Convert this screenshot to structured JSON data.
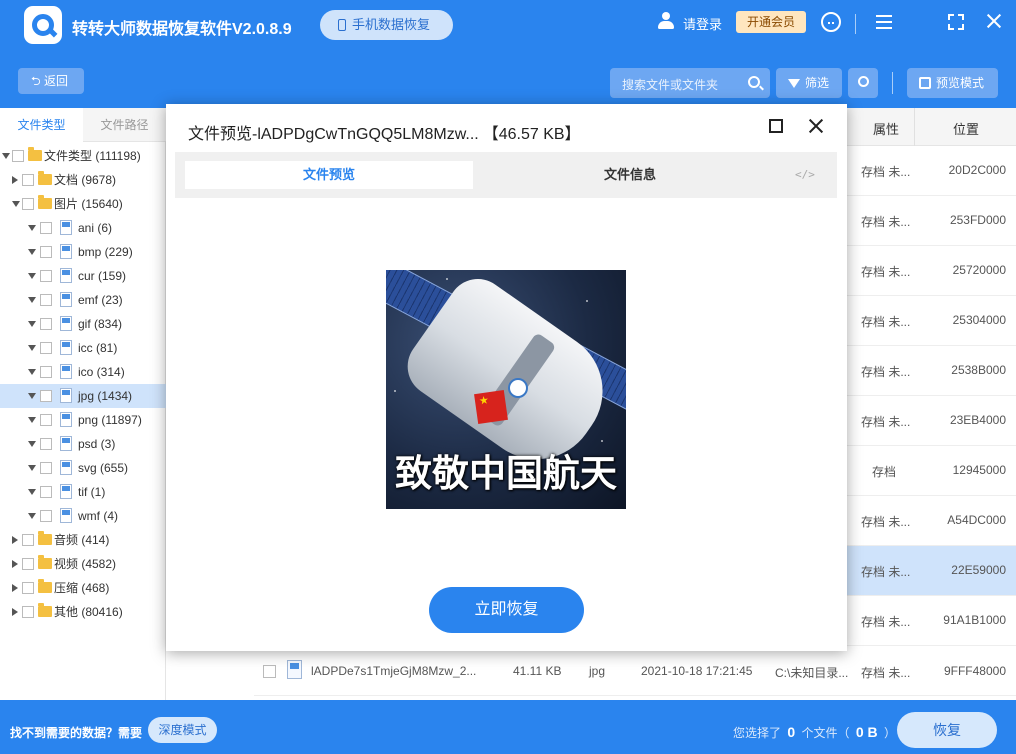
{
  "app": {
    "title": "转转大师数据恢复软件V2.0.8.9",
    "phone_recovery": "手机数据恢复",
    "login": "请登录",
    "vip": "开通会员"
  },
  "toolbar": {
    "back": "返回",
    "search_placeholder": "搜索文件或文件夹",
    "filter": "筛选",
    "preview_mode": "预览模式"
  },
  "sidebar": {
    "tabs": [
      "文件类型",
      "文件路径"
    ],
    "tree": [
      {
        "label": "文件类型 (111198)",
        "level": 0,
        "arrow": "down",
        "icon": "folder",
        "selected": false
      },
      {
        "label": "文档 (9678)",
        "level": 1,
        "arrow": "right",
        "icon": "folder",
        "selected": false
      },
      {
        "label": "图片 (15640)",
        "level": 1,
        "arrow": "down",
        "icon": "folder",
        "selected": false
      },
      {
        "label": "ani (6)",
        "level": 2,
        "arrow": "down",
        "icon": "file",
        "selected": false
      },
      {
        "label": "bmp (229)",
        "level": 2,
        "arrow": "down",
        "icon": "file",
        "selected": false
      },
      {
        "label": "cur (159)",
        "level": 2,
        "arrow": "down",
        "icon": "file",
        "selected": false
      },
      {
        "label": "emf (23)",
        "level": 2,
        "arrow": "down",
        "icon": "file",
        "selected": false
      },
      {
        "label": "gif (834)",
        "level": 2,
        "arrow": "down",
        "icon": "file",
        "selected": false
      },
      {
        "label": "icc (81)",
        "level": 2,
        "arrow": "down",
        "icon": "file",
        "selected": false
      },
      {
        "label": "ico (314)",
        "level": 2,
        "arrow": "down",
        "icon": "file",
        "selected": false
      },
      {
        "label": "jpg (1434)",
        "level": 2,
        "arrow": "down",
        "icon": "file",
        "selected": true
      },
      {
        "label": "png (11897)",
        "level": 2,
        "arrow": "down",
        "icon": "file",
        "selected": false
      },
      {
        "label": "psd (3)",
        "level": 2,
        "arrow": "down",
        "icon": "file",
        "selected": false
      },
      {
        "label": "svg (655)",
        "level": 2,
        "arrow": "down",
        "icon": "file",
        "selected": false
      },
      {
        "label": "tif (1)",
        "level": 2,
        "arrow": "down",
        "icon": "file",
        "selected": false
      },
      {
        "label": "wmf (4)",
        "level": 2,
        "arrow": "down",
        "icon": "file",
        "selected": false
      },
      {
        "label": "音频 (414)",
        "level": 1,
        "arrow": "right",
        "icon": "folder",
        "selected": false
      },
      {
        "label": "视频 (4582)",
        "level": 1,
        "arrow": "right",
        "icon": "folder",
        "selected": false
      },
      {
        "label": "压缩 (468)",
        "level": 1,
        "arrow": "right",
        "icon": "folder",
        "selected": false
      },
      {
        "label": "其他 (80416)",
        "level": 1,
        "arrow": "right",
        "icon": "folder",
        "selected": false
      }
    ]
  },
  "list": {
    "col_attr": "属性",
    "col_pos": "位置",
    "rows": [
      {
        "attr": "存档 未...",
        "pos": "20D2C000",
        "selected": false
      },
      {
        "attr": "存档 未...",
        "pos": "253FD000",
        "selected": false
      },
      {
        "attr": "存档 未...",
        "pos": "25720000",
        "selected": false
      },
      {
        "attr": "存档 未...",
        "pos": "25304000",
        "selected": false
      },
      {
        "attr": "存档 未...",
        "pos": "2538B000",
        "selected": false
      },
      {
        "attr": "存档 未...",
        "pos": "23EB4000",
        "selected": false
      },
      {
        "attr": "存档",
        "pos": "12945000",
        "selected": false
      },
      {
        "attr": "存档 未...",
        "pos": "A54DC000",
        "selected": false
      },
      {
        "attr": "存档 未...",
        "pos": "22E59000",
        "selected": true
      },
      {
        "attr": "存档 未...",
        "pos": "91A1B1000",
        "selected": false
      }
    ],
    "last_row": {
      "name": "lADPDe7s1TmjeGjM8Mzw_2...",
      "size": "41.11 KB",
      "type": "jpg",
      "date": "2021-10-18 17:21:45",
      "path": "C:\\未知目录...",
      "attr": "存档 未...",
      "pos": "9FFF48000"
    }
  },
  "modal": {
    "title": "文件预览-lADPDgCwTnGQQ5LM8Mzw...",
    "size": "【46.57 KB】",
    "tab_preview": "文件预览",
    "tab_info": "文件信息",
    "code_glyph": "</>",
    "image_caption": "致敬中国航天",
    "recover": "立即恢复"
  },
  "bottom": {
    "not_found": "找不到需要的数据？需要",
    "deep_mode": "深度模式",
    "selected_prefix": "您选择了",
    "selected_count": "0",
    "selected_mid": "个文件（",
    "selected_size": "0 B",
    "selected_suffix": "）",
    "recover": "恢复"
  },
  "colors": {
    "brand": "#2a84ee",
    "selection": "#cfe3fb",
    "vip": "#ffe6bf"
  }
}
